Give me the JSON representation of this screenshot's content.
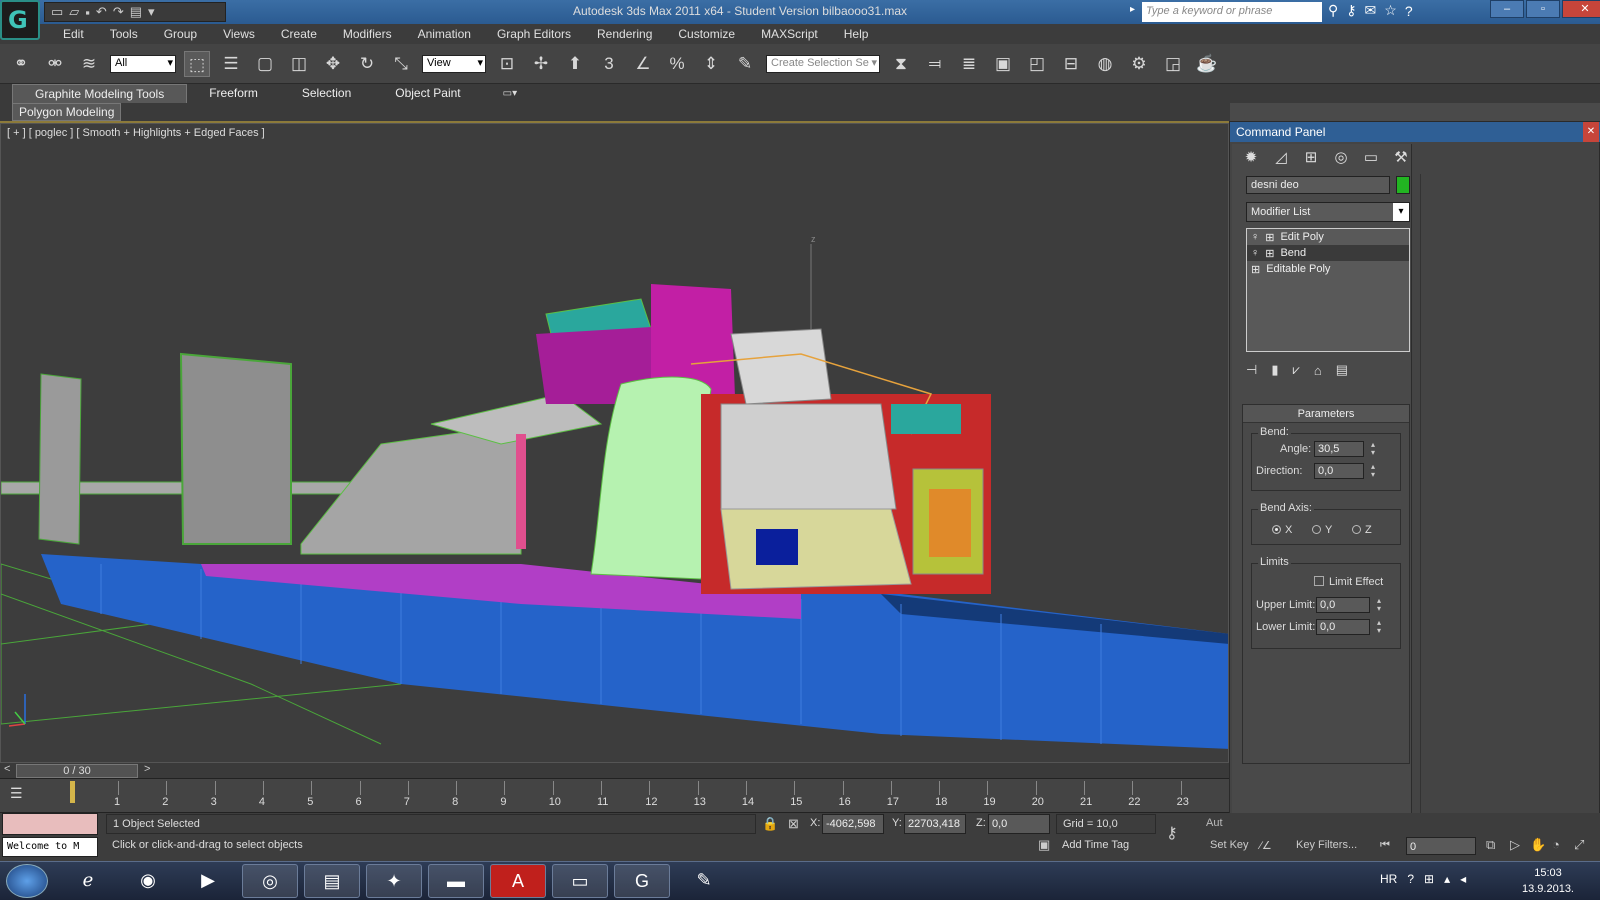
{
  "window": {
    "title": "Autodesk 3ds Max  2011 x64  - Student Version   bilbaooo31.max",
    "search_placeholder": "Type a keyword or phrase"
  },
  "menu": [
    "Edit",
    "Tools",
    "Group",
    "Views",
    "Create",
    "Modifiers",
    "Animation",
    "Graph Editors",
    "Rendering",
    "Customize",
    "MAXScript",
    "Help"
  ],
  "toolbar": {
    "filter": "All",
    "coord_system": "View",
    "selection_set_placeholder": "Create Selection Se"
  },
  "ribbon": {
    "tabs": [
      "Graphite Modeling Tools",
      "Freeform",
      "Selection",
      "Object Paint"
    ],
    "sub_tab": "Polygon Modeling"
  },
  "viewport": {
    "label": "[ + ] [ poglec ] [ Smooth + Highlights + Edged Faces ]",
    "axis_z": "z"
  },
  "command_panel": {
    "title": "Command Panel",
    "object_name": "desni deo",
    "object_color": "#22b522",
    "modifier_list": "Modifier List",
    "stack": [
      "Edit Poly",
      "Bend",
      "Editable Poly"
    ],
    "parameters": {
      "title": "Parameters",
      "bend_group": "Bend:",
      "angle_label": "Angle:",
      "angle": "30,5",
      "direction_label": "Direction:",
      "direction": "0,0",
      "axis_group": "Bend Axis:",
      "axes": [
        "X",
        "Y",
        "Z"
      ],
      "selected_axis": "X",
      "limits_group": "Limits",
      "limit_effect": "Limit Effect",
      "upper_label": "Upper Limit:",
      "upper": "0,0",
      "lower_label": "Lower Limit:",
      "lower": "0,0"
    }
  },
  "time_slider": {
    "frame": "0 / 30",
    "ticks": [
      "1",
      "2",
      "3",
      "4",
      "5",
      "6",
      "7",
      "8",
      "9",
      "10",
      "11",
      "12",
      "13",
      "14",
      "15",
      "16",
      "17",
      "18",
      "19",
      "20",
      "21",
      "22",
      "23"
    ]
  },
  "status": {
    "listener": "Welcome to M",
    "selection": "1 Object Selected",
    "prompt": "Click or click-and-drag to select objects",
    "x_label": "X:",
    "x": "-4062,598",
    "y_label": "Y:",
    "y": "22703,418",
    "z_label": "Z:",
    "z": "0,0",
    "grid": "Grid = 10,0",
    "add_time_tag": "Add Time Tag",
    "auto_key": "Aut",
    "set_key": "Set Key",
    "key_filters": "Key Filters...",
    "current_frame": "0"
  },
  "taskbar": {
    "lang": "HR",
    "time": "15:03",
    "date": "13.9.2013."
  }
}
